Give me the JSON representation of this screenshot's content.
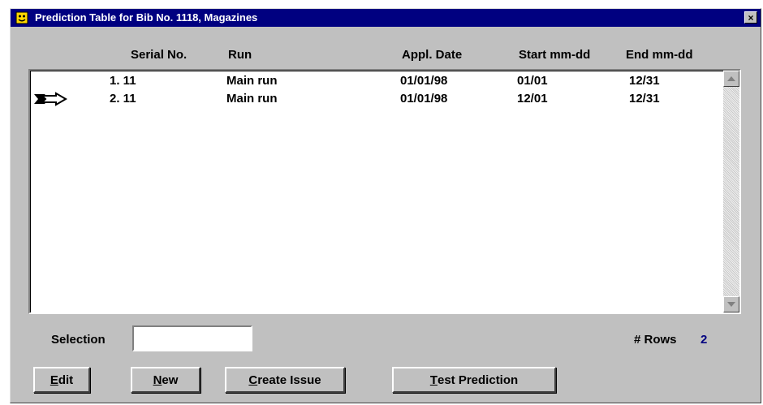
{
  "window": {
    "title": "Prediction Table for Bib No. 1118, Magazines",
    "close_glyph": "×",
    "icon": "notes-app-icon"
  },
  "columns": {
    "serial": "Serial No.",
    "run": "Run",
    "appl_date": "Appl. Date",
    "start": "Start mm-dd",
    "end": "End mm-dd"
  },
  "rows": [
    {
      "serial": "1. 11",
      "run": "Main run",
      "appl_date": "01/01/98",
      "start": "01/01",
      "end": "12/31",
      "current": false
    },
    {
      "serial": "2. 11",
      "run": "Main run",
      "appl_date": "01/01/98",
      "start": "12/01",
      "end": "12/31",
      "current": true
    }
  ],
  "selection": {
    "label": "Selection",
    "value": ""
  },
  "row_count": {
    "label": "# Rows",
    "value": "2"
  },
  "buttons": {
    "edit": {
      "mnemonic": "E",
      "rest": "dit"
    },
    "new": {
      "mnemonic": "N",
      "rest": "ew"
    },
    "create": {
      "mnemonic": "C",
      "rest": "reate Issue"
    },
    "test": {
      "mnemonic": "T",
      "rest": "est Prediction"
    }
  },
  "colors": {
    "titlebar": "#000080",
    "window_bg": "#c0c0c0",
    "rows_value": "#000080"
  }
}
